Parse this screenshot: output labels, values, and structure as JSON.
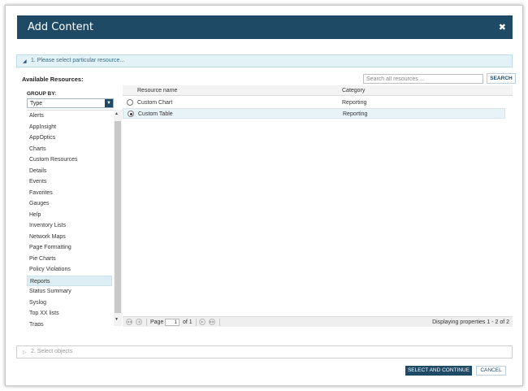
{
  "dialog": {
    "title": "Add Content",
    "close_glyph": "✖"
  },
  "step1": {
    "label": "1. Please select particular resource..."
  },
  "step2": {
    "label": "2. Select objects"
  },
  "available_resources_label": "Available Resources:",
  "search": {
    "placeholder": "Search all resources ...",
    "button_label": "SEARCH"
  },
  "group_by": {
    "label": "GROUP BY:",
    "selected": "Type",
    "items": [
      "Alerts",
      "AppInsight",
      "AppOptics",
      "Charts",
      "Custom Resources",
      "Details",
      "Events",
      "Favorites",
      "Gauges",
      "Help",
      "Inventory Lists",
      "Network Maps",
      "Page Formatting",
      "Pie Charts",
      "Policy Violations",
      "Reports",
      "Status Summary",
      "Syslog",
      "Top XX lists",
      "Traps"
    ],
    "selected_item": "Reports"
  },
  "grid": {
    "columns": [
      "Resource name",
      "Category"
    ],
    "rows": [
      {
        "name": "Custom Chart",
        "category": "Reporting",
        "checked": false
      },
      {
        "name": "Custom Table",
        "category": "Reporting",
        "checked": true
      }
    ]
  },
  "pager": {
    "page_label": "Page",
    "page_value": "1",
    "of_label": "of 1",
    "display_text": "Displaying properties 1 - 2 of 2"
  },
  "footer": {
    "select_button": "SELECT AND CONTINUE",
    "cancel_button": "CANCEL"
  },
  "colors": {
    "header": "#1f4a66",
    "accent_light": "#e2f2f6"
  }
}
